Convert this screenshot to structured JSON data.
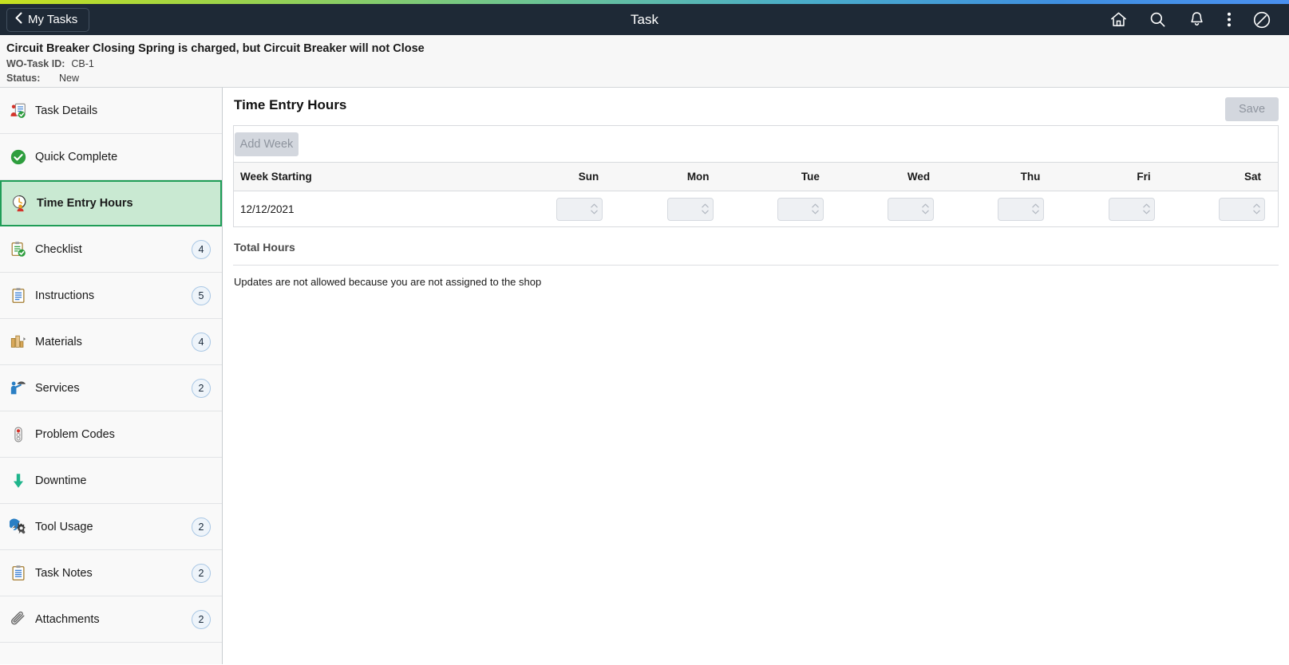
{
  "navbar": {
    "back_label": "My Tasks",
    "title": "Task",
    "icons": [
      "home-icon",
      "search-icon",
      "notifications-bell-icon",
      "kebab-menu-icon",
      "navigator-compass-icon"
    ]
  },
  "task_header": {
    "title": "Circuit Breaker Closing Spring is charged, but Circuit Breaker will not Close",
    "wo_task_id_label": "WO-Task ID:",
    "wo_task_id_value": "CB-1",
    "status_label": "Status:",
    "status_value": "New"
  },
  "sidebar": {
    "items": [
      {
        "label": "Task Details",
        "icon": "task-details-icon",
        "badge": "",
        "selected": false
      },
      {
        "label": "Quick Complete",
        "icon": "check-circle-icon",
        "badge": "",
        "selected": false
      },
      {
        "label": "Time Entry Hours",
        "icon": "clock-person-icon",
        "badge": "",
        "selected": true
      },
      {
        "label": "Checklist",
        "icon": "checklist-icon",
        "badge": "4",
        "selected": false
      },
      {
        "label": "Instructions",
        "icon": "instructions-icon",
        "badge": "5",
        "selected": false
      },
      {
        "label": "Materials",
        "icon": "materials-icon",
        "badge": "4",
        "selected": false
      },
      {
        "label": "Services",
        "icon": "services-icon",
        "badge": "2",
        "selected": false
      },
      {
        "label": "Problem Codes",
        "icon": "traffic-light-icon",
        "badge": "",
        "selected": false
      },
      {
        "label": "Downtime",
        "icon": "down-arrow-icon",
        "badge": "",
        "selected": false
      },
      {
        "label": "Tool Usage",
        "icon": "wrench-gear-icon",
        "badge": "2",
        "selected": false
      },
      {
        "label": "Task Notes",
        "icon": "notes-clipboard-icon",
        "badge": "2",
        "selected": false
      },
      {
        "label": "Attachments",
        "icon": "paperclip-icon",
        "badge": "2",
        "selected": false
      }
    ]
  },
  "main": {
    "page_title": "Time Entry Hours",
    "save_label": "Save",
    "add_week_label": "Add Week",
    "columns": [
      "Week Starting",
      "Sun",
      "Mon",
      "Tue",
      "Wed",
      "Thu",
      "Fri",
      "Sat"
    ],
    "rows": [
      {
        "week_starting": "12/12/2021",
        "hours": [
          "",
          "",
          "",
          "",
          "",
          "",
          ""
        ],
        "placeholder": ""
      }
    ],
    "total_hours_label": "Total Hours",
    "notice": "Updates are not allowed because you are not assigned to the shop"
  },
  "colors": {
    "navbar_bg": "#1e2936",
    "selected_item_bg": "#c9e9d2",
    "selected_item_border": "#1f9d57",
    "badge_border": "#a9c7e4",
    "disabled_button_bg": "#d3d7de"
  }
}
